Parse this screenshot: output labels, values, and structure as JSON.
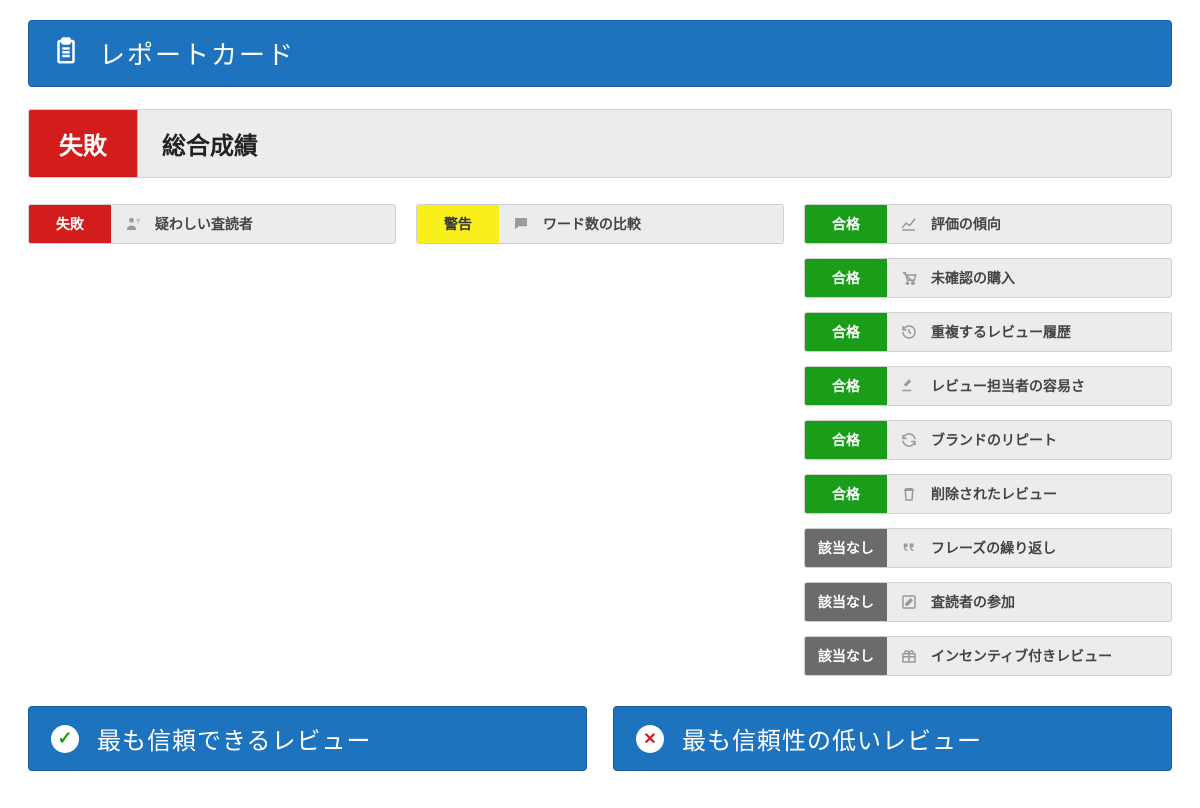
{
  "header": {
    "title": "レポートカード"
  },
  "overall": {
    "badge": "失敗",
    "label": "総合成績"
  },
  "columns": {
    "fail": [
      {
        "badge": "失敗",
        "label": "疑わしい査読者",
        "icon": "person-question-icon"
      }
    ],
    "warn": [
      {
        "badge": "警告",
        "label": "ワード数の比較",
        "icon": "comment-icon"
      }
    ],
    "other": [
      {
        "badge": "合格",
        "status": "pass",
        "label": "評価の傾向",
        "icon": "chart-line-icon"
      },
      {
        "badge": "合格",
        "status": "pass",
        "label": "未確認の購入",
        "icon": "cart-off-icon"
      },
      {
        "badge": "合格",
        "status": "pass",
        "label": "重複するレビュー履歴",
        "icon": "history-icon"
      },
      {
        "badge": "合格",
        "status": "pass",
        "label": "レビュー担当者の容易さ",
        "icon": "gavel-icon"
      },
      {
        "badge": "合格",
        "status": "pass",
        "label": "ブランドのリピート",
        "icon": "refresh-icon"
      },
      {
        "badge": "合格",
        "status": "pass",
        "label": "削除されたレビュー",
        "icon": "trash-icon"
      },
      {
        "badge": "該当なし",
        "status": "na",
        "label": "フレーズの繰り返し",
        "icon": "quote-icon"
      },
      {
        "badge": "該当なし",
        "status": "na",
        "label": "査読者の参加",
        "icon": "edit-icon"
      },
      {
        "badge": "該当なし",
        "status": "na",
        "label": "インセンティブ付きレビュー",
        "icon": "gift-icon"
      }
    ]
  },
  "bottom": {
    "trusted": "最も信頼できるレビュー",
    "untrusted": "最も信頼性の低いレビュー"
  }
}
